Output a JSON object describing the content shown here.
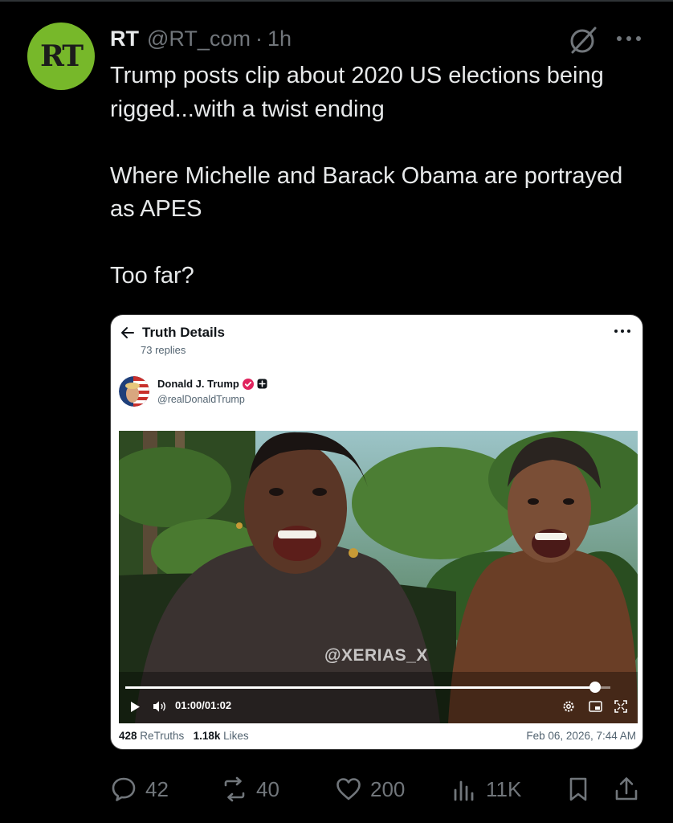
{
  "tweet": {
    "avatar_text": "RT",
    "author_name": "RT",
    "handle": "@RT_com",
    "separator": "·",
    "time": "1h",
    "text": "Trump posts clip about 2020 US elections being rigged...with a twist ending\n\nWhere Michelle and Barack Obama are portrayed as APES\n\nToo far?",
    "icons": {
      "grok": "grok-icon",
      "more": "more-horizontal-icon"
    }
  },
  "embed": {
    "title": "Truth Details",
    "subtitle": "73 replies",
    "author_name": "Donald J. Trump",
    "author_handle": "@realDonaldTrump",
    "video": {
      "watermark": "@XERIAS_X",
      "time_display": "01:00/01:02",
      "progress_fraction": 0.968
    },
    "retruths_count": "428",
    "retruths_label": "ReTruths",
    "likes_count": "1.18k",
    "likes_label": "Likes",
    "posted_at": "Feb 06, 2026, 7:44 AM"
  },
  "actions": {
    "replies": "42",
    "reposts": "40",
    "likes": "200",
    "views": "11K"
  },
  "colors": {
    "background": "#000000",
    "text": "#e7e9ea",
    "muted": "#71767b",
    "rt_green": "#77b82a",
    "truth_verified": "#e0245e"
  }
}
